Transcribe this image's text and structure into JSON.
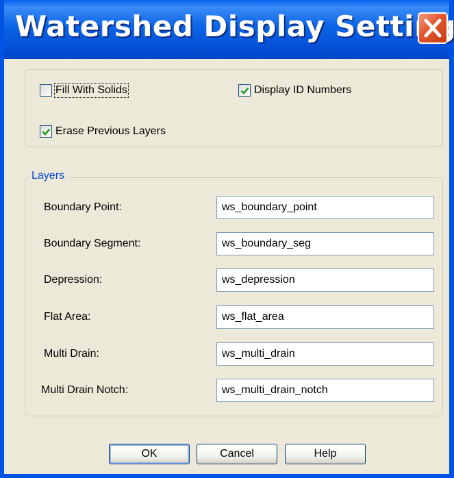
{
  "window": {
    "title": "Watershed Display Settings"
  },
  "options": {
    "fill_with_solids": {
      "label": "Fill With Solids",
      "checked": false
    },
    "display_id_numbers": {
      "label": "Display ID Numbers",
      "checked": true
    },
    "erase_previous_layers": {
      "label": "Erase Previous Layers",
      "checked": true
    }
  },
  "layers": {
    "legend": "Layers",
    "rows": [
      {
        "label": "Boundary Point:",
        "value": "ws_boundary_point"
      },
      {
        "label": "Boundary Segment:",
        "value": "ws_boundary_seg"
      },
      {
        "label": "Depression:",
        "value": "ws_depression"
      },
      {
        "label": "Flat Area:",
        "value": "ws_flat_area"
      },
      {
        "label": "Multi Drain:",
        "value": "ws_multi_drain"
      },
      {
        "label": "Multi Drain Notch:",
        "value": "ws_multi_drain_notch"
      }
    ]
  },
  "buttons": {
    "ok": "OK",
    "cancel": "Cancel",
    "help": "Help"
  },
  "colors": {
    "title_bar": "#0054E3",
    "close_button": "#E2552E",
    "dialog_bg": "#ECE9D8",
    "group_legend": "#0046D5",
    "checkmark": "#21A121"
  },
  "icons": {
    "close": "close-icon",
    "check": "checkmark-icon"
  }
}
